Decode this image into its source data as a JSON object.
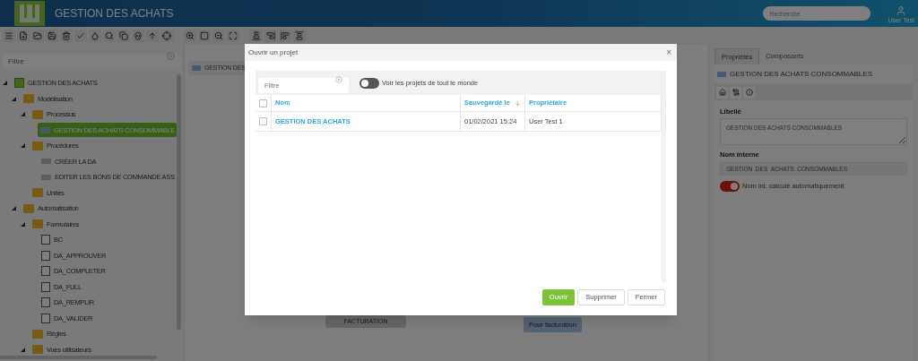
{
  "header": {
    "title": "GESTION DES ACHATS",
    "search": {
      "placeholder": "Recherche"
    },
    "user": "User Test"
  },
  "sidebar": {
    "filter": {
      "placeholder": "Filtre"
    },
    "tree": [
      {
        "label": "GESTION DES ACHATS",
        "kind": "app",
        "expanded": true,
        "selected": false,
        "children": [
          {
            "label": "Modélisation",
            "kind": "folder",
            "expanded": true,
            "selected": false,
            "children": [
              {
                "label": "Processus",
                "kind": "folder",
                "expanded": true,
                "selected": false,
                "children": [
                  {
                    "label": "GESTION DES ACHATS CONSOMMABLE",
                    "kind": "process",
                    "selected": true
                  }
                ]
              },
              {
                "label": "Procédures",
                "kind": "folder",
                "expanded": true,
                "selected": false,
                "children": [
                  {
                    "label": "CRÉER LA DA",
                    "kind": "procedure",
                    "selected": false
                  },
                  {
                    "label": "EDITER LES BONS DE COMMANDE ASS",
                    "kind": "procedure",
                    "selected": false
                  }
                ]
              },
              {
                "label": "Unités",
                "kind": "folder",
                "selected": false
              }
            ]
          },
          {
            "label": "Automatisation",
            "kind": "folder",
            "expanded": true,
            "selected": false,
            "children": [
              {
                "label": "Formulaires",
                "kind": "folder",
                "expanded": true,
                "selected": false,
                "children": [
                  {
                    "label": "BC",
                    "kind": "form",
                    "selected": false
                  },
                  {
                    "label": "DA_APPROUVER",
                    "kind": "form",
                    "selected": false
                  },
                  {
                    "label": "DA_COMPLETER",
                    "kind": "form",
                    "selected": false
                  },
                  {
                    "label": "DA_FULL",
                    "kind": "form",
                    "selected": false
                  },
                  {
                    "label": "DA_REMPLIR",
                    "kind": "form",
                    "selected": false
                  },
                  {
                    "label": "DA_VALIDER",
                    "kind": "form",
                    "selected": false
                  }
                ]
              },
              {
                "label": "Règles",
                "kind": "folder",
                "selected": false
              },
              {
                "label": "Vues utilisateurs",
                "kind": "folder",
                "expanded": true,
                "selected": false
              }
            ]
          }
        ]
      }
    ]
  },
  "canvas": {
    "tab": "GESTION DES",
    "nodes": [
      {
        "label": "FACTURATION",
        "kind": "task"
      },
      {
        "label": "Pour facturation",
        "kind": "note"
      }
    ]
  },
  "properties": {
    "tabs": [
      {
        "label": "Propriétés",
        "selected": true
      },
      {
        "label": "Composants",
        "selected": false
      }
    ],
    "title": "GESTION DES ACHATS CONSOMMABLES",
    "libelle": {
      "label": "Libellé",
      "value": "GESTION DES ACHATS CONSOMMABLES"
    },
    "nom_interne": {
      "label": "Nom interne",
      "value": "GESTION_DES_ACHATS_CONSOMMABLES"
    },
    "auto_toggle": {
      "label": "Nom int. calculé automatiquement",
      "on": true
    }
  },
  "dialog": {
    "title": "Ouvrir un projet",
    "close": "×",
    "filter": {
      "placeholder": "Filtre"
    },
    "toggle": {
      "label": "Voir les projets de tout le monde",
      "on": false
    },
    "table": {
      "all_checked": false,
      "columns": [
        "Nom",
        "Sauvegardé le",
        "Propriétaire"
      ],
      "rows": [
        {
          "checked": false,
          "cells": [
            "GESTION DES ACHATS",
            "01/02/2021 15:24",
            "User Test 1"
          ]
        }
      ]
    },
    "buttons": [
      {
        "label": "Ouvrir",
        "kind": "primary"
      },
      {
        "label": "Supprimer",
        "kind": "default"
      },
      {
        "label": "Fermer",
        "kind": "default"
      }
    ]
  }
}
